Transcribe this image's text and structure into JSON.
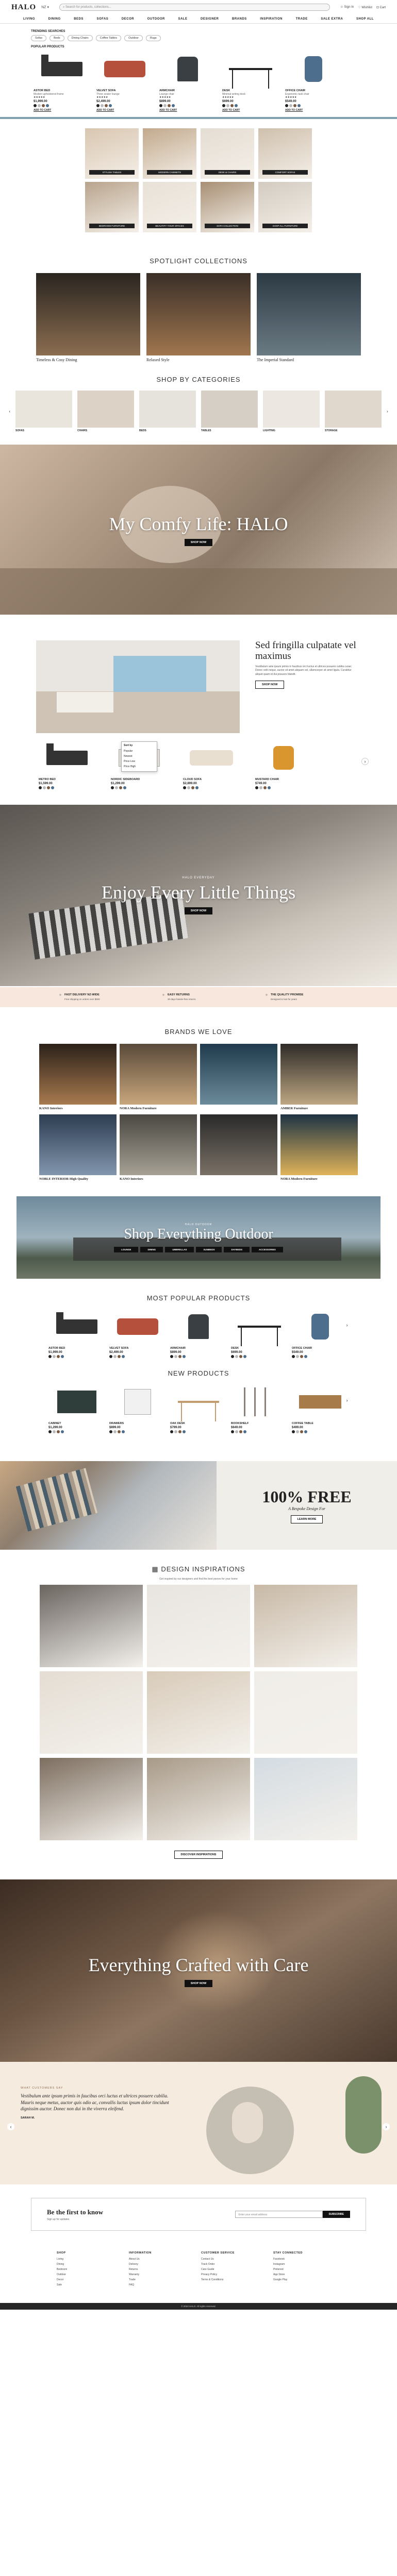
{
  "header": {
    "logo": "HALO",
    "region": "NZ",
    "search_placeholder": "Search for products, collections...",
    "sign_in": "Sign In",
    "wishlist": "Wishlist",
    "cart": "Cart"
  },
  "nav": [
    "LIVING",
    "DINING",
    "BEDS",
    "SOFAS",
    "DECOR",
    "OUTDOOR",
    "SALE",
    "DESIGNER",
    "BRANDS",
    "INSPIRATION",
    "TRADE",
    "SALE EXTRA",
    "SHOP ALL"
  ],
  "mega": {
    "section1_title": "TRENDING SEARCHES",
    "chips": [
      "Sofas",
      "Beds",
      "Dining Chairs",
      "Coffee Tables",
      "Outdoor",
      "Rugs"
    ],
    "section2_title": "POPULAR PRODUCTS"
  },
  "products_top": [
    {
      "name": "ASTOR BED",
      "desc": "Modern upholstered frame",
      "price": "$1,999.00",
      "stars": "★★★★★",
      "atc": "ADD TO CART"
    },
    {
      "name": "VELVET SOFA",
      "desc": "Three seater lounge",
      "price": "$2,499.00",
      "stars": "★★★★★",
      "atc": "ADD TO CART"
    },
    {
      "name": "ARMCHAIR",
      "desc": "Lounge chair",
      "price": "$899.00",
      "stars": "★★★★★",
      "atc": "ADD TO CART"
    },
    {
      "name": "DESK",
      "desc": "Minimal writing desk",
      "price": "$699.00",
      "stars": "★★★★★",
      "atc": "ADD TO CART"
    },
    {
      "name": "OFFICE CHAIR",
      "desc": "Ergonomic task chair",
      "price": "$549.00",
      "stars": "★★★★★",
      "atc": "ADD TO CART"
    }
  ],
  "rooms": [
    "STYLISH TABLES",
    "MODERN CABINETS",
    "DESK & CHAIRS",
    "COMFORT SOFAS",
    "BEDROOM FURNITURE",
    "BEAUTIFY YOUR SPACES",
    "SOFA COLLECTION",
    "SHOP ALL FURNITURE"
  ],
  "spotlight": {
    "title": "SPOTLIGHT COLLECTIONS",
    "items": [
      "Timeless & Cosy Dining",
      "Relaxed Style",
      "The Imperial Standard"
    ]
  },
  "categories": {
    "title": "SHOP BY CATEGORIES",
    "items": [
      "SOFAS",
      "CHAIRS",
      "BEDS",
      "TABLES",
      "LIGHTING",
      "STORAGE"
    ]
  },
  "hero1": {
    "title": "My Comfy Life: HALO",
    "button": "SHOP NOW"
  },
  "feature": {
    "title": "Sed fringilla culpatate vel maximus",
    "body": "Vestibulum ante ipsum primis in faucibus orci luctus et ultrices posuere cubilia curae; Donec velit neque, auctor sit amet aliquam vel, ullamcorper sit amet ligula. Curabitur aliquet quam id dui posuere blandit.",
    "button": "SHOP NOW",
    "dropdown_title": "Sort by",
    "dropdown_items": [
      "Popular",
      "Newest",
      "Price Low",
      "Price High"
    ]
  },
  "products_feature": [
    {
      "name": "METRO BED",
      "price": "$1,599.00"
    },
    {
      "name": "NORDIC SIDEBOARD",
      "price": "$1,299.00"
    },
    {
      "name": "CLOUD SOFA",
      "price": "$2,899.00"
    },
    {
      "name": "MUSTARD CHAIR",
      "price": "$749.00"
    }
  ],
  "hero2": {
    "eyebrow": "HALO EVERYDAY",
    "title": "Enjoy Every Little Things",
    "button": "SHOP NOW"
  },
  "usp": [
    {
      "title": "FAST DELIVERY NZ-WIDE",
      "text": "Free shipping on orders over $500"
    },
    {
      "title": "EASY RETURNS",
      "text": "30 days hassle-free returns"
    },
    {
      "title": "THE QUALITY PROMISE",
      "text": "Designed to last for years"
    }
  ],
  "brands": {
    "title": "BRANDS WE LOVE",
    "items": [
      "KANO Interiors",
      "NORA Modern Furniture",
      "AMBER Furniture",
      "NOBLE INTERIOR High Quality",
      "KANO Interiors",
      "NORA Modern Furniture"
    ]
  },
  "hero3": {
    "eyebrow": "HALO OUTDOOR",
    "title": "Shop Everything Outdoor",
    "chips": [
      "LOUNGE",
      "DINING",
      "UMBRELLAS",
      "SUNBEDS",
      "DAYBEDS",
      "ACCESSORIES"
    ]
  },
  "popular": {
    "title": "MOST POPULAR PRODUCTS",
    "items": [
      {
        "name": "ASTOR BED",
        "price": "$1,999.00"
      },
      {
        "name": "VELVET SOFA",
        "price": "$2,499.00"
      },
      {
        "name": "ARMCHAIR",
        "price": "$899.00"
      },
      {
        "name": "DESK",
        "price": "$699.00"
      },
      {
        "name": "OFFICE CHAIR",
        "price": "$549.00"
      }
    ]
  },
  "new_products": {
    "title": "NEW PRODUCTS",
    "items": [
      {
        "name": "CABINET",
        "price": "$1,299.00"
      },
      {
        "name": "DRAWERS",
        "price": "$899.00"
      },
      {
        "name": "OAK DESK",
        "price": "$799.00"
      },
      {
        "name": "BOOKSHELF",
        "price": "$649.00"
      },
      {
        "name": "COFFEE TABLE",
        "price": "$499.00"
      }
    ]
  },
  "free_promo": {
    "title": "100% FREE",
    "subtitle": "A Bespoke Design For",
    "button": "LEARN MORE"
  },
  "inspirations": {
    "title": "DESIGN INSPIRATIONS",
    "subtitle": "Get inspired by our designers and find the best pieces for your home",
    "button": "DISCOVER INSPIRATIONS"
  },
  "hero4": {
    "title": "Everything Crafted with Care",
    "button": "SHOP NOW"
  },
  "testimonial": {
    "eyebrow": "WHAT CUSTOMERS SAY",
    "quote": "Vestibulum ante ipsum primis in faucibus orci luctus et ultrices posuere cubilia. Mauris neque metus, auctor quis odio ac, convallis luctus ipsum dolor tincidunt dignissim auctor. Donec non dui in the viverra eleifend.",
    "author": "SARAH M."
  },
  "newsletter": {
    "title": "Be the first to know",
    "text": "Sign up for updates",
    "placeholder": "Enter your email address",
    "button": "SUBSCRIBE"
  },
  "footer": {
    "cols": [
      {
        "title": "SHOP",
        "items": [
          "Living",
          "Dining",
          "Bedroom",
          "Outdoor",
          "Decor",
          "Sale"
        ]
      },
      {
        "title": "INFORMATION",
        "items": [
          "About Us",
          "Delivery",
          "Returns",
          "Warranty",
          "Trade",
          "FAQ"
        ]
      },
      {
        "title": "CUSTOMER SERVICE",
        "items": [
          "Contact Us",
          "Track Order",
          "Care Guide",
          "Privacy Policy",
          "Terms & Conditions"
        ]
      },
      {
        "title": "STAY CONNECTED",
        "items": [
          "Facebook",
          "Instagram",
          "Pinterest",
          "App Store",
          "Google Play"
        ]
      }
    ],
    "copyright": "© 2024 HALO. All rights reserved."
  },
  "colors": {
    "accent": "#7fa0ac",
    "peach": "#f8e7dc",
    "cream": "#f5ebdf"
  }
}
